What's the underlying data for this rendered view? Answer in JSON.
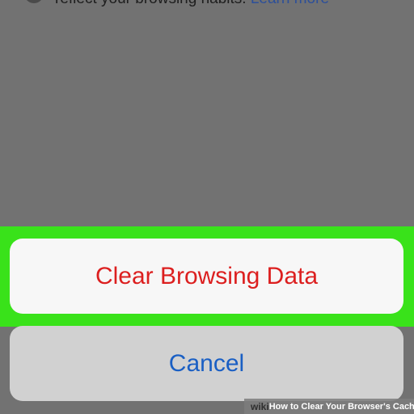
{
  "privacy_note": {
    "text": "reflect your browsing habits. ",
    "link": "Learn more"
  },
  "action_sheet": {
    "clear_label": "Clear Browsing Data",
    "cancel_label": "Cancel"
  },
  "watermark": {
    "brand": "wiki",
    "title": "How to Clear Your Browser's Cache"
  },
  "colors": {
    "highlight": "#39e21a",
    "destructive": "#dc1f1f",
    "cancel": "#1a5fc4"
  }
}
